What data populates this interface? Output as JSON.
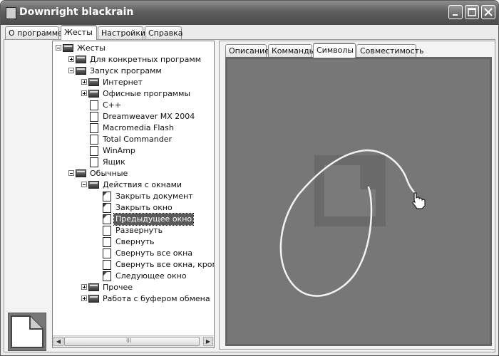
{
  "window": {
    "title": "Downright blackrain"
  },
  "main_tabs": [
    "О программе",
    "Жесты",
    "Настройки",
    "Справка"
  ],
  "sub_tabs": [
    "Описание",
    "Комманды",
    "Символы",
    "Совместимость"
  ],
  "tree": [
    {
      "label": "Жесты",
      "level": 0,
      "expander": "minus",
      "icon": "folder"
    },
    {
      "label": "Для конкретных программ",
      "level": 1,
      "expander": "plus",
      "icon": "folder"
    },
    {
      "label": "Запуск программ",
      "level": 1,
      "expander": "minus",
      "icon": "folder"
    },
    {
      "label": "Интернет",
      "level": 2,
      "expander": "plus",
      "icon": "folder"
    },
    {
      "label": "Офисные программы",
      "level": 2,
      "expander": "plus",
      "icon": "folder"
    },
    {
      "label": "C++",
      "level": 2,
      "expander": "",
      "icon": "doc"
    },
    {
      "label": "Dreamweaver MX 2004",
      "level": 2,
      "expander": "",
      "icon": "doc"
    },
    {
      "label": "Macromedia Flash",
      "level": 2,
      "expander": "",
      "icon": "doc"
    },
    {
      "label": "Total Commander",
      "level": 2,
      "expander": "",
      "icon": "doc"
    },
    {
      "label": "WinAmp",
      "level": 2,
      "expander": "",
      "icon": "doc"
    },
    {
      "label": "Ящик",
      "level": 2,
      "expander": "",
      "icon": "doc"
    },
    {
      "label": "Обычные",
      "level": 1,
      "expander": "minus",
      "icon": "folder"
    },
    {
      "label": "Действия с окнами",
      "level": 2,
      "expander": "minus",
      "icon": "folder"
    },
    {
      "label": "Закрыть документ",
      "level": 3,
      "expander": "",
      "icon": "doc-dark"
    },
    {
      "label": "Закрыть окно",
      "level": 3,
      "expander": "",
      "icon": "doc-dark"
    },
    {
      "label": "Предыдущее окно",
      "level": 3,
      "expander": "",
      "icon": "doc-dark",
      "selected": true
    },
    {
      "label": "Развернуть",
      "level": 3,
      "expander": "",
      "icon": "doc"
    },
    {
      "label": "Свернуть",
      "level": 3,
      "expander": "",
      "icon": "doc"
    },
    {
      "label": "Свернуть все окна",
      "level": 3,
      "expander": "",
      "icon": "doc"
    },
    {
      "label": "Свернуть все окна, кроме ак",
      "level": 3,
      "expander": "",
      "icon": "doc"
    },
    {
      "label": "Следующее окно",
      "level": 3,
      "expander": "",
      "icon": "doc-dark"
    },
    {
      "label": "Прочее",
      "level": 2,
      "expander": "plus",
      "icon": "folder"
    },
    {
      "label": "Работа с буфером обмена",
      "level": 2,
      "expander": "plus",
      "icon": "folder"
    }
  ],
  "scroll_grip": "III"
}
